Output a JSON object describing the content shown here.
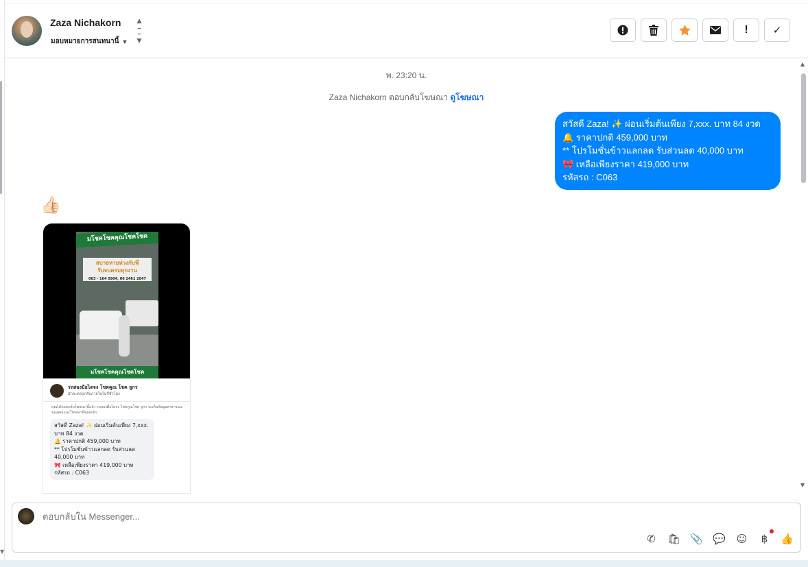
{
  "header": {
    "contact_name": "Zaza Nichakorn",
    "assign_label": "มอบหมายการสนทนานี้",
    "actions": [
      {
        "icon": "alert-circle-icon"
      },
      {
        "icon": "trash-icon"
      },
      {
        "icon": "star-icon",
        "color": "#f7923a"
      },
      {
        "icon": "envelope-icon"
      },
      {
        "icon": "exclamation-icon"
      },
      {
        "icon": "check-icon"
      }
    ]
  },
  "conversation": {
    "timestamp": "พ. 23:20 น.",
    "replied_text": "Zaza Nichakorn ตอบกลับโฆษณา",
    "replied_link": "ดูโฆษณา",
    "outgoing_lines": [
      "สวัสดี Zaza! ✨  ผ่อนเริ่มต้นเพียง 7,xxx. บาท 84 งวด",
      "🔔 ราคาปกติ 459,000 บาท",
      "** โปรโมชั่นข้าวแลกลด รับส่วนลด 40,000 บาท",
      "🎀  เหลือเพียงราคา 419,000 บาท",
      " รหัสรถ : C063"
    ],
    "incoming_emoji": "👍🏻",
    "ad_card": {
      "banner_top": "มโชคโชคคุณโชคโชค",
      "sign_line1": "สบายหายห่วงกับพี่",
      "sign_line2": "รับจบครบทุกงาน",
      "sign_line3": "063 - 164 5904, 06 2461 2047",
      "banner_bottom": "มโชคโชคคุณโชคโชค",
      "page_name": "รถสองมือไดจง โชคคูณ โชค ลูกร",
      "page_sub": "มักจะตอบกลับภายในไม่กี่ชั่วโมง",
      "description": "คุณได้ตอบกลับโฆษณานี้แล้ว รถสองมือไดจง โชคคูณโชค ลูกร จะเห็นข้อมูลสาธารณะของคุณและโฆษณาที่คุณคลิก",
      "bubble_lines": [
        "สวัสดี Zaza! ✨  ผ่อนเริ่มต้นเพียง 7,xxx.",
        "บาท 84 งวด",
        "🔔 ราคาปกติ 459,000 บาท",
        "** โปรโมชั่นข้าวแลกลด รับส่วนลด",
        "40,000 บาท",
        "🎀  เหลือเพียงราคา 419,000 บาท",
        " รหัสรถ : C063"
      ]
    }
  },
  "composer": {
    "placeholder": "ตอบกลับใน Messenger...",
    "tools": [
      {
        "icon": "phone-plus-icon",
        "glyph": "✆"
      },
      {
        "icon": "shopping-bag-icon",
        "glyph": "🛍"
      },
      {
        "icon": "paperclip-icon",
        "glyph": "📎"
      },
      {
        "icon": "chat-bubble-icon",
        "glyph": "💬"
      },
      {
        "icon": "smiley-icon",
        "glyph": "☺"
      },
      {
        "icon": "baht-icon",
        "glyph": "฿"
      },
      {
        "icon": "thumbs-up-icon",
        "glyph": "👍"
      }
    ]
  }
}
